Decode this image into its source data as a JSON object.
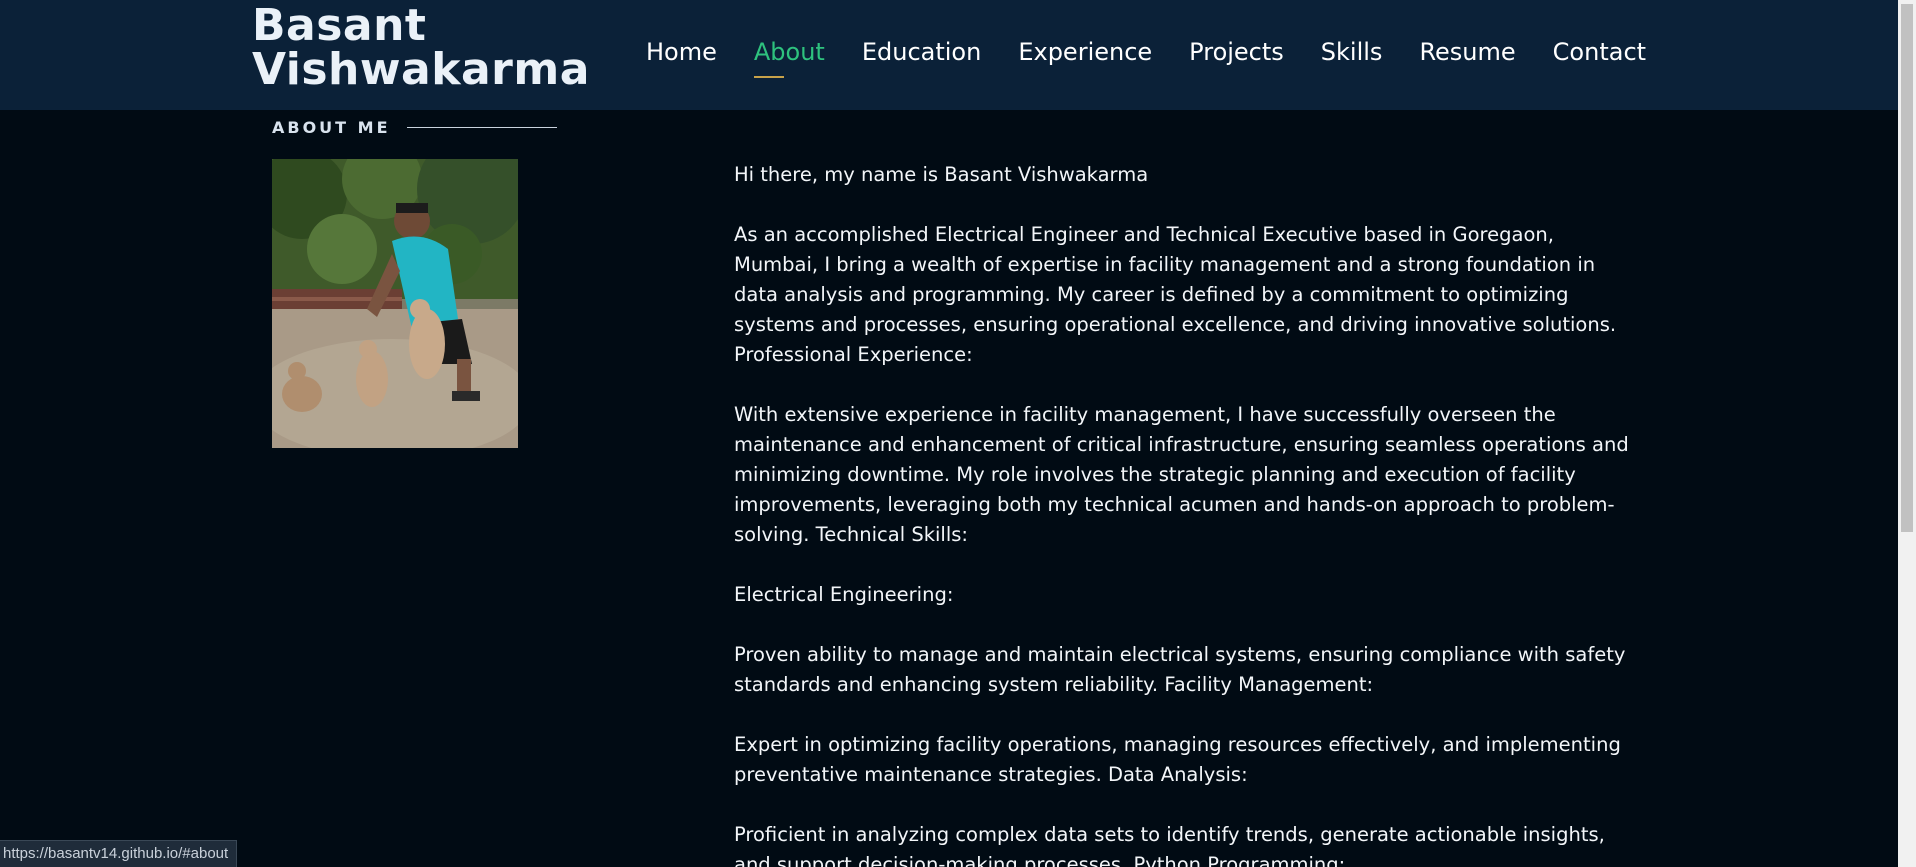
{
  "brand": {
    "line1": "Basant",
    "line2": "Vishwakarma"
  },
  "nav": {
    "items": [
      "Home",
      "About",
      "Education",
      "Experience",
      "Projects",
      "Skills",
      "Resume",
      "Contact"
    ],
    "active": "About"
  },
  "about": {
    "section_title": "ABOUT ME",
    "paragraphs": [
      "Hi there, my name is Basant Vishwakarma",
      "As an accomplished Electrical Engineer and Technical Executive based in Goregaon, Mumbai, I bring a wealth of expertise in facility management and a strong foundation in data analysis and programming. My career is defined by a commitment to optimizing systems and processes, ensuring operational excellence, and driving innovative solutions. Professional Experience:",
      "With extensive experience in facility management, I have successfully overseen the maintenance and enhancement of critical infrastructure, ensuring seamless operations and minimizing downtime. My role involves the strategic planning and execution of facility improvements, leveraging both my technical acumen and hands-on approach to problem-solving. Technical Skills:",
      "Electrical Engineering:",
      "Proven ability to manage and maintain electrical systems, ensuring compliance with safety standards and enhancing system reliability. Facility Management:",
      "Expert in optimizing facility operations, managing resources effectively, and implementing preventative maintenance strategies. Data Analysis:",
      "Proficient in analyzing complex data sets to identify trends, generate actionable insights, and support decision-making processes. Python Programming:"
    ]
  },
  "status_bar": {
    "url": "https://basantv14.github.io/#about"
  },
  "colors": {
    "header_bg": "#0b2138",
    "page_bg": "#010b14",
    "active_nav": "#2ec27e",
    "active_underline": "#c8a24a"
  }
}
